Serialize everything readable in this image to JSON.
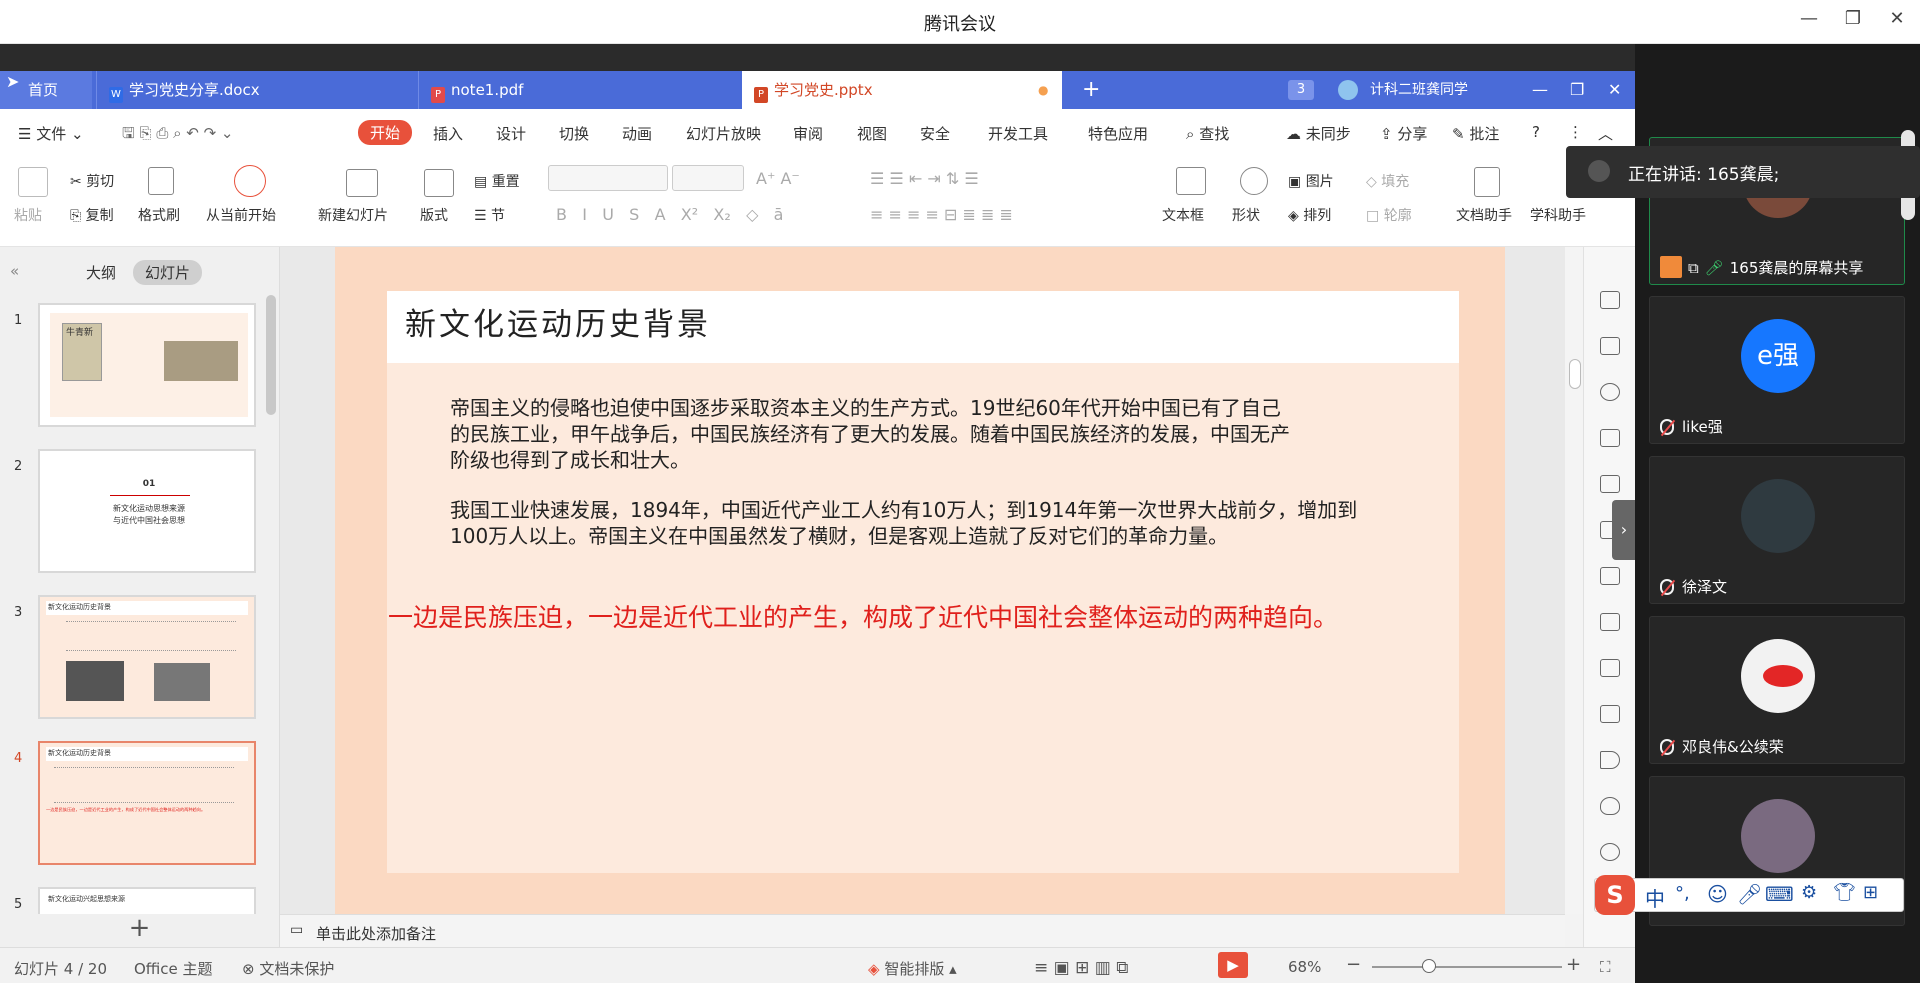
{
  "window": {
    "title": "腾讯会议"
  },
  "tabs": {
    "home": "首页",
    "docx": "学习党史分享.docx",
    "pdf": "note1.pdf",
    "pptx": "学习党史.pptx",
    "doc_count": "3",
    "user": "计科二班龚同学"
  },
  "menu": {
    "file": "文件",
    "items": [
      "开始",
      "插入",
      "设计",
      "切换",
      "动画",
      "幻灯片放映",
      "审阅",
      "视图",
      "安全",
      "开发工具",
      "特色应用"
    ],
    "search": "查找",
    "sync": "未同步",
    "share": "分享",
    "comment": "批注"
  },
  "ribbon": {
    "paste": "粘贴",
    "cut": "剪切",
    "copy": "复制",
    "format_painter": "格式刷",
    "play_from_current": "从当前开始",
    "new_slide": "新建幻灯片",
    "layout": "版式",
    "reset": "重置",
    "section": "节",
    "textbox": "文本框",
    "shape": "形状",
    "picture": "图片",
    "arrange": "排列",
    "fill": "填充",
    "outline": "轮廓",
    "doc_assistant": "文档助手",
    "subject_assistant": "学科助手"
  },
  "sidebar": {
    "outline_tab": "大纲",
    "slides_tab": "幻灯片",
    "slide_numbers": [
      "1",
      "2",
      "3",
      "4",
      "5"
    ]
  },
  "thumbs": {
    "t1_title": "牛青新",
    "t2_num": "01",
    "t2_line1": "新文化运动思想来源",
    "t2_line2": "与近代中国社会思想",
    "t3_title": "新文化运动历史背景",
    "t4_title": "新文化运动历史背景",
    "t4_red": "一边是民族压迫，一边是近代工业的产生，构成了近代中国社会整体运动的两种趋向。",
    "t5_title": "新文化运动兴起思想来源"
  },
  "slide": {
    "title": "新文化运动历史背景",
    "p1_l1": "帝国主义的侵略也迫使中国逐步采取资本主义的生产方式。19世纪60年代开始中国已有了自己",
    "p1_l2": "的民族工业，甲午战争后，中国民族经济有了更大的发展。随着中国民族经济的发展，中国无产",
    "p1_l3": "阶级也得到了成长和壮大。",
    "p2_l1": "我国工业快速发展，1894年，中国近代产业工人约有10万人；到1914年第一次世界大战前夕，增加到",
    "p2_l2": "100万人以上。帝国主义在中国虽然发了横财，但是客观上造就了反对它们的革命力量。",
    "red": "一边是民族压迫，一边是近代工业的产生，构成了近代中国社会整体运动的两种趋向。"
  },
  "notes": {
    "placeholder": "单击此处添加备注"
  },
  "status": {
    "slide_index": "幻灯片 4 / 20",
    "theme": "Office 主题",
    "protect": "文档未保护",
    "smart": "智能排版",
    "zoom": "68%"
  },
  "meeting": {
    "speaking": "正在讲话: 165龚晨;",
    "sharing_label": "165龚晨的屏幕共享",
    "participants": [
      "like强",
      "徐泽文",
      "邓良伟&公续荣"
    ],
    "avatar_text": "e强"
  },
  "ime": {
    "mode": "中",
    "punct": "°,"
  },
  "colors": {
    "wps_blue": "#4a6bd8",
    "wps_accent": "#e8513b",
    "slide_bg": "#fbd9c2",
    "red_text": "#e0201c"
  }
}
